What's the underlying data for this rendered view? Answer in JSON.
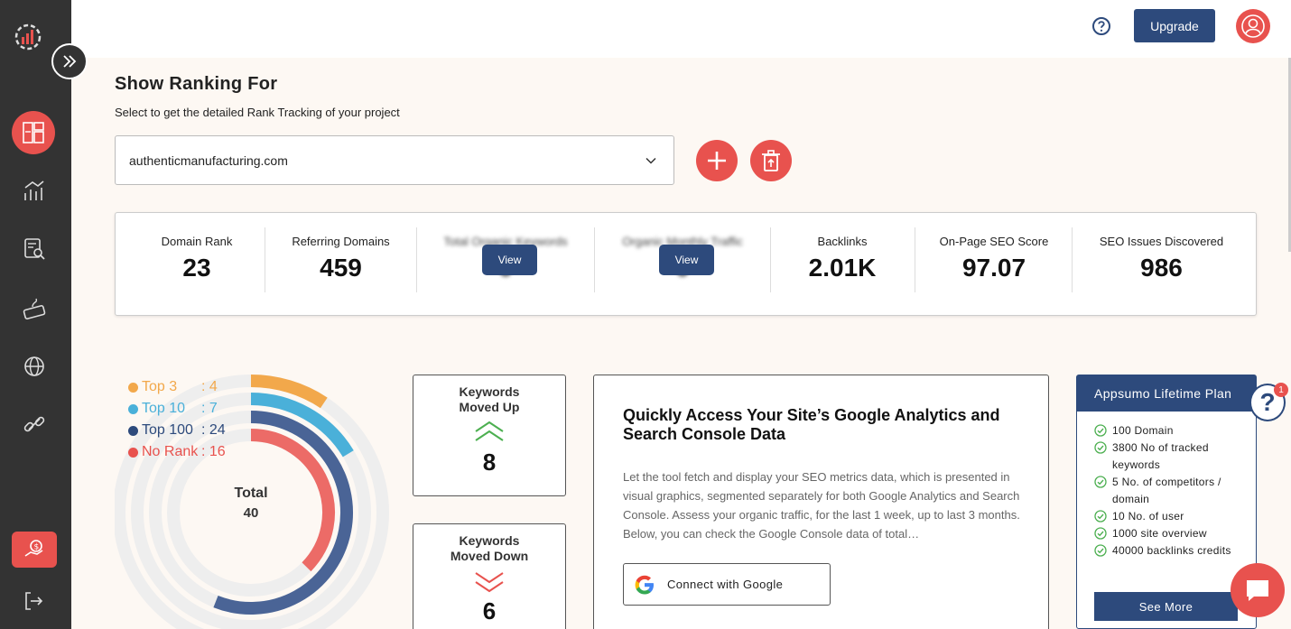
{
  "header": {
    "upgrade_label": "Upgrade"
  },
  "page": {
    "title": "Show Ranking For",
    "subtitle": "Select to get the detailed Rank Tracking of your project",
    "selected_domain": "authenticmanufacturing.com"
  },
  "stats": [
    {
      "label": "Domain Rank",
      "value": "23"
    },
    {
      "label": "Referring Domains",
      "value": "459"
    },
    {
      "label": "Total Organic Keywords",
      "value": "0",
      "button": "View"
    },
    {
      "label": "Organic Monthly Traffic",
      "value": "0",
      "button": "View"
    },
    {
      "label": "Backlinks",
      "value": "2.01K"
    },
    {
      "label": "On-Page SEO Score",
      "value": "97.07"
    },
    {
      "label": "SEO Issues Discovered",
      "value": "986"
    }
  ],
  "ranking": {
    "legend": [
      {
        "name": "Top 3",
        "value": ": 4",
        "color": "#f2a84b"
      },
      {
        "name": "Top 10",
        "value": ": 7",
        "color": "#4ab0d9"
      },
      {
        "name": "Top 100",
        "value": ": 24",
        "color": "#2d4a7c"
      },
      {
        "name": "No Rank",
        "value": ": 16",
        "color": "#e8524e"
      }
    ],
    "total_label": "Total",
    "total_value": "40"
  },
  "chart_data": {
    "type": "pie",
    "categories": [
      "Top 3",
      "Top 10",
      "Top 100",
      "No Rank"
    ],
    "values": [
      4,
      7,
      24,
      16
    ],
    "title": "",
    "colors": [
      "#f2a84b",
      "#4ab0d9",
      "#4a6496",
      "#ec6b67"
    ]
  },
  "keywords": {
    "up_title_1": "Keywords",
    "up_title_2": "Moved Up",
    "up_value": "8",
    "down_title_1": "Keywords",
    "down_title_2": "Moved Down",
    "down_value": "6"
  },
  "ga": {
    "title": "Quickly Access Your Site’s Google Analytics and Search Console Data",
    "text": "Let the tool fetch and display your SEO metrics data, which is presented in visual graphics, segmented separately for both Google Analytics and Search Console. Assess your organic traffic, for the last 1 week, up to last 3 months. Below, you can check the Google Console data of total…",
    "connect_label": "Connect with Google"
  },
  "plan": {
    "title": "Appsumo Lifetime Plan",
    "features": [
      "100 Domain",
      "3800 No of tracked keywords",
      "5 No. of competitors / domain",
      "10 No. of user",
      "1000 site overview",
      "40000 backlinks credits"
    ],
    "see_more": "See More"
  },
  "help_badge": "1",
  "help_glyph": "?"
}
